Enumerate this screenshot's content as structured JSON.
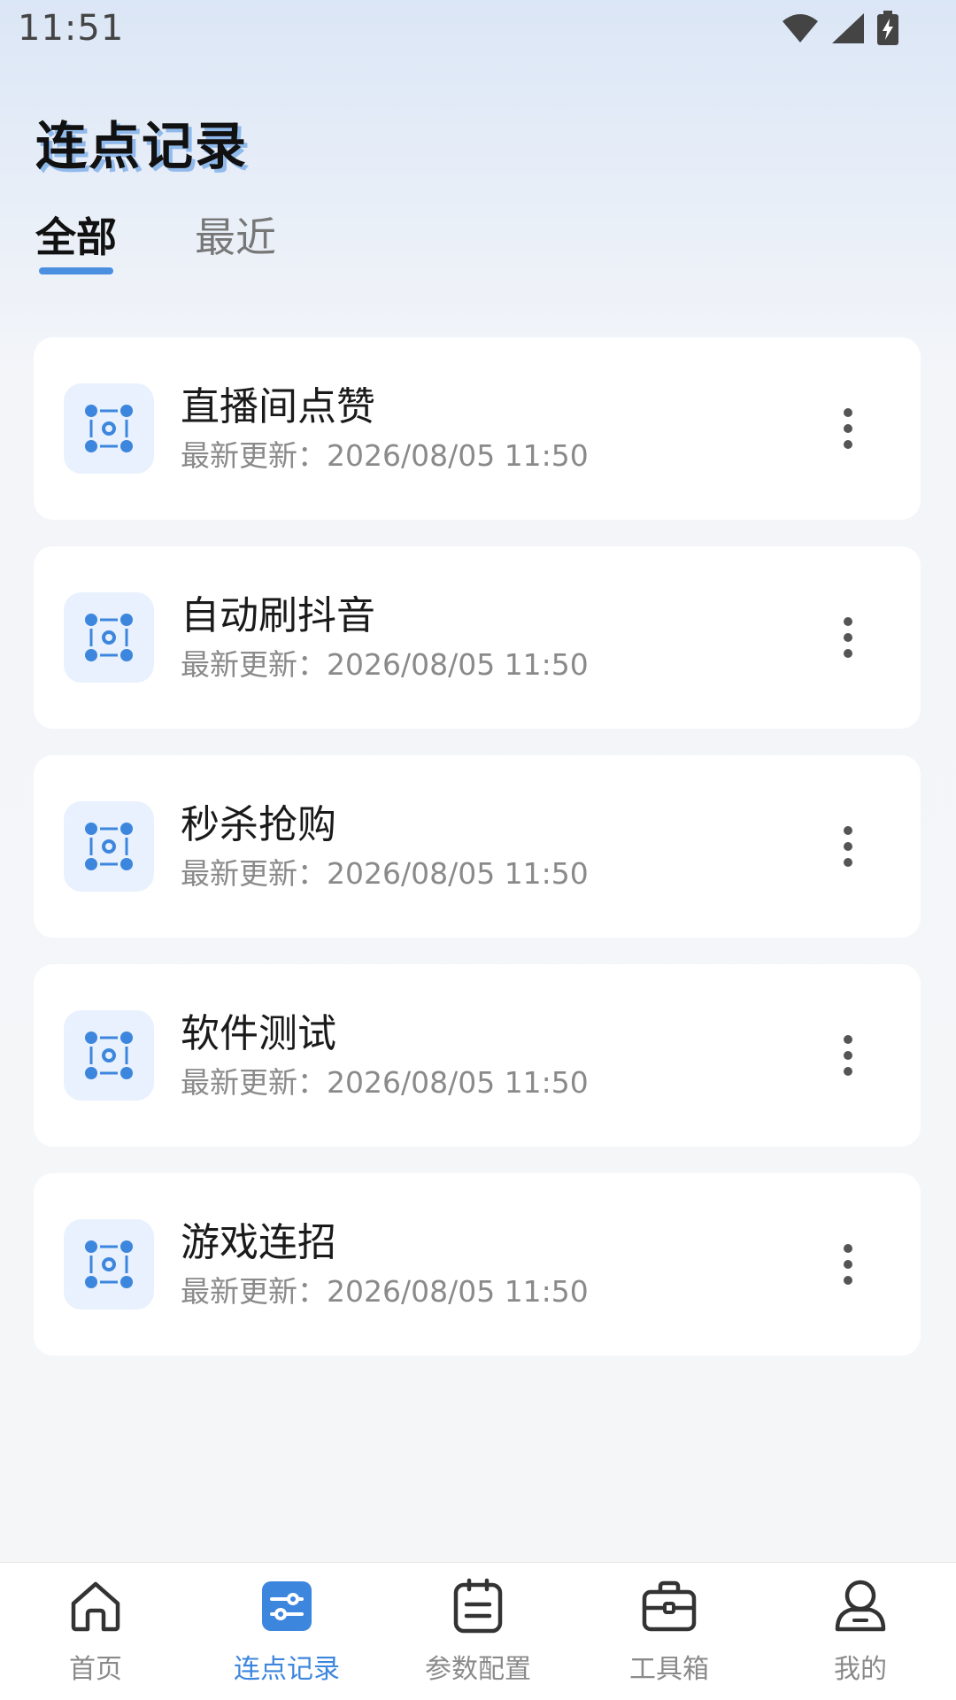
{
  "status_bar": {
    "time": "11:51"
  },
  "header": {
    "title": "连点记录"
  },
  "tabs": [
    {
      "label": "全部",
      "active": true
    },
    {
      "label": "最近",
      "active": false
    }
  ],
  "records": [
    {
      "title": "直播间点赞",
      "subtitle": "最新更新：2026/08/05 11:50"
    },
    {
      "title": "自动刷抖音",
      "subtitle": "最新更新：2026/08/05 11:50"
    },
    {
      "title": "秒杀抢购",
      "subtitle": "最新更新：2026/08/05 11:50"
    },
    {
      "title": "软件测试",
      "subtitle": "最新更新：2026/08/05 11:50"
    },
    {
      "title": "游戏连招",
      "subtitle": "最新更新：2026/08/05 11:50"
    }
  ],
  "bottom_nav": [
    {
      "label": "首页",
      "icon": "home-icon"
    },
    {
      "label": "连点记录",
      "icon": "sliders-icon",
      "active": true
    },
    {
      "label": "参数配置",
      "icon": "notepad-icon"
    },
    {
      "label": "工具箱",
      "icon": "toolbox-icon"
    },
    {
      "label": "我的",
      "icon": "user-icon"
    }
  ],
  "colors": {
    "accent": "#3d86de",
    "icon_bg": "#e8f1fd",
    "card_bg": "#ffffff"
  }
}
